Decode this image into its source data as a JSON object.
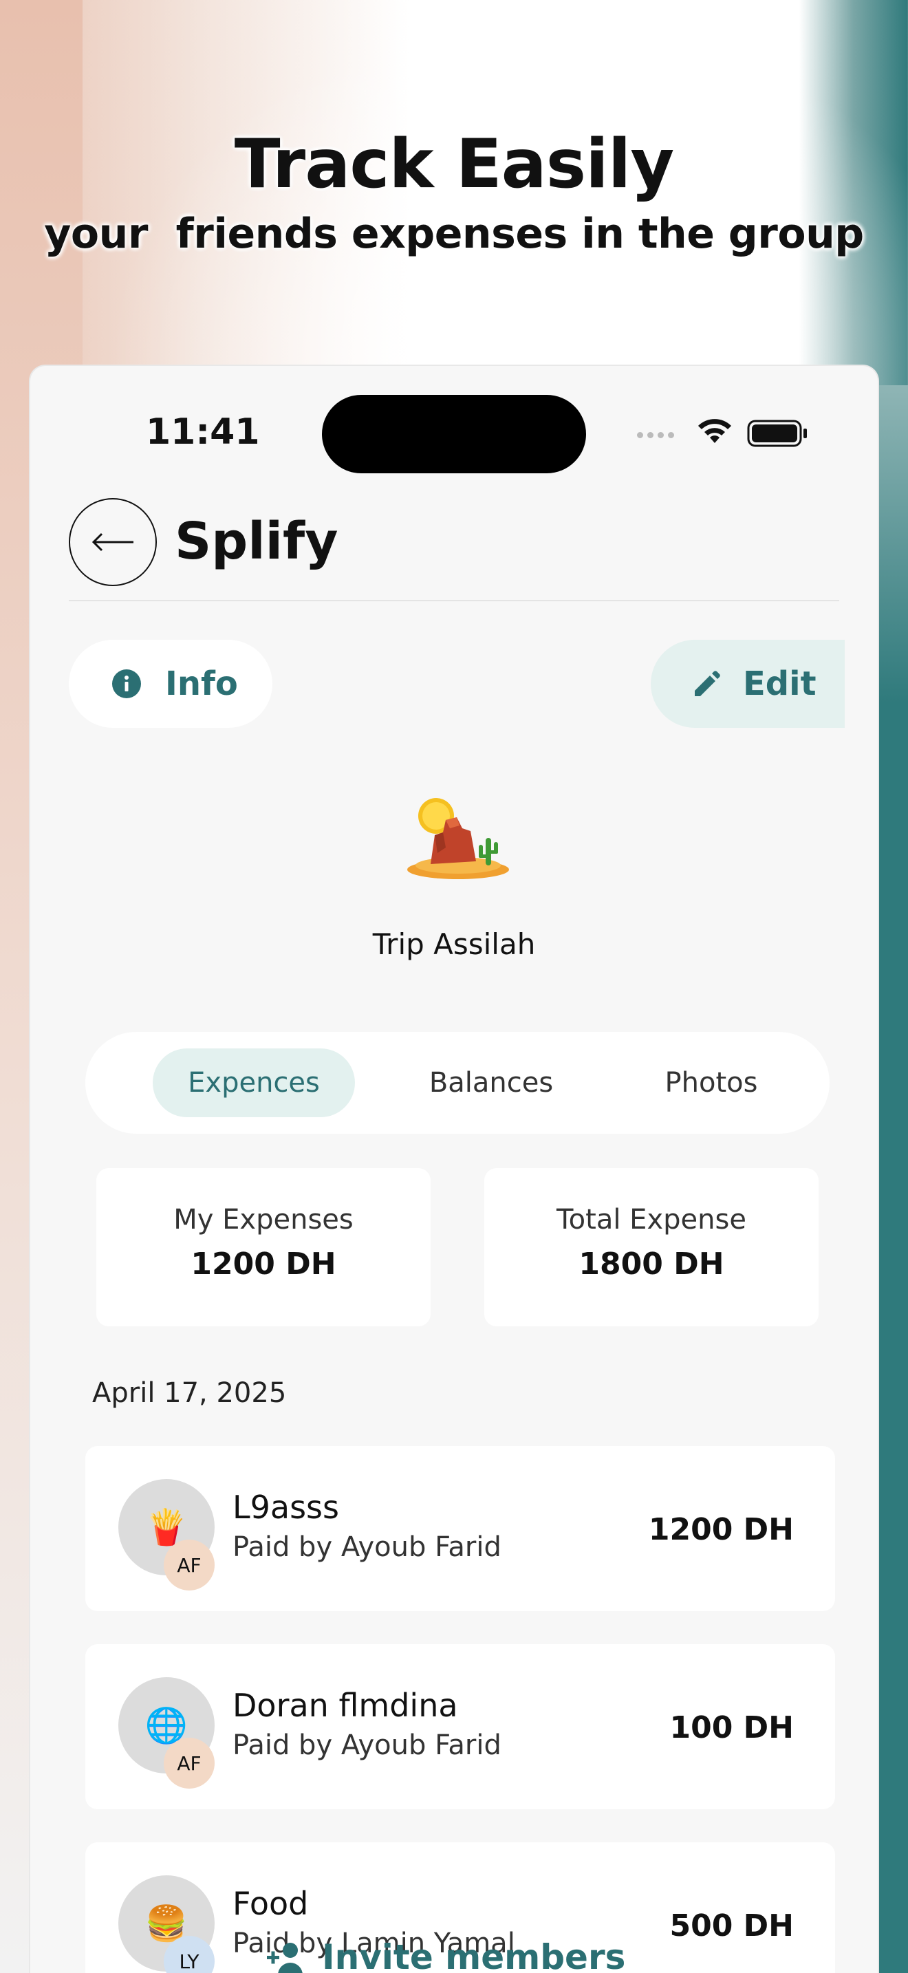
{
  "headline": {
    "title": "Track Easily",
    "subtitle": "your  friends expenses in the group"
  },
  "status_bar": {
    "time": "11:41"
  },
  "nav": {
    "title": "Splify"
  },
  "actions": {
    "info_label": "Info",
    "edit_label": "Edit"
  },
  "group": {
    "name": "Trip Assilah"
  },
  "tabs": [
    {
      "label": "Expences",
      "active": true
    },
    {
      "label": "Balances",
      "active": false
    },
    {
      "label": "Photos",
      "active": false
    }
  ],
  "stats": {
    "my_label": "My Expenses",
    "my_value": "1200 DH",
    "total_label": "Total Expense",
    "total_value": "1800 DH"
  },
  "date_label": "April 17, 2025",
  "expenses": [
    {
      "title": "L9asss",
      "paid_by": "Paid by Ayoub Farid",
      "amount": "1200 DH",
      "icon": "fries-icon",
      "glyph": "🍟",
      "initials": "AF"
    },
    {
      "title": "Doran flmdina",
      "paid_by": "Paid by Ayoub Farid",
      "amount": "100 DH",
      "icon": "globe-icon",
      "glyph": "🌐",
      "initials": "AF"
    },
    {
      "title": "Food",
      "paid_by": "Paid by Lamin Yamal",
      "amount": "500 DH",
      "icon": "burger-icon",
      "glyph": "🍔",
      "initials": "LY"
    }
  ],
  "invite": {
    "label": "Invite members"
  },
  "colors": {
    "accent": "#2b6f73",
    "accent_soft": "#e3f1ef",
    "page_bg": "#f7f7f7"
  }
}
